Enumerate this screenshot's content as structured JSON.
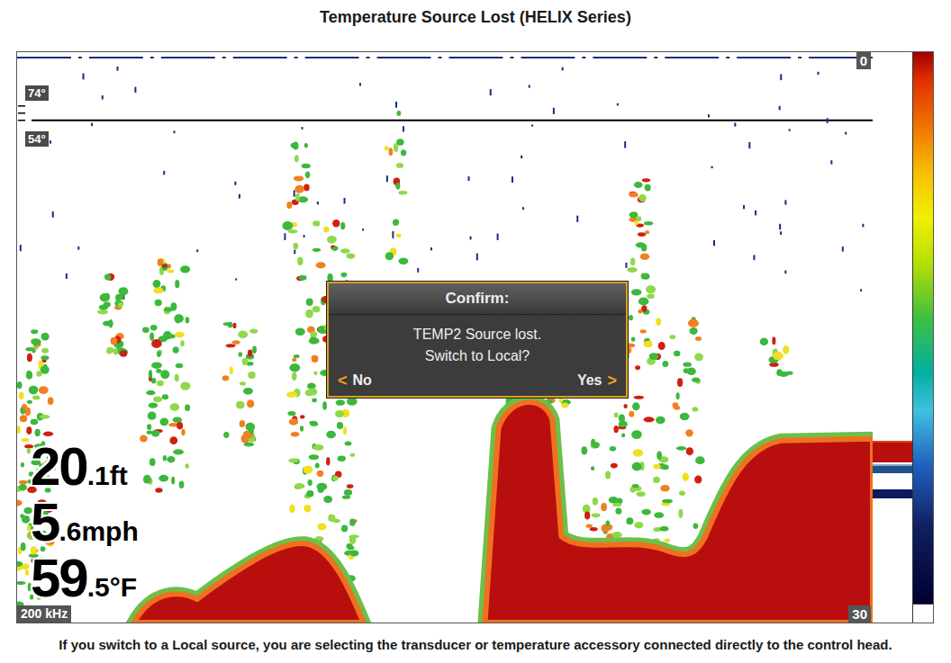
{
  "title": "Temperature Source Lost (HELIX Series)",
  "screen": {
    "temp_scale": [
      "74°",
      "54°"
    ],
    "depth_top": "0",
    "depth_bottom": "30",
    "frequency": "200 kHz",
    "readouts": [
      {
        "value": "20",
        "detail": ".1ft"
      },
      {
        "value": "5",
        "detail": ".6mph"
      },
      {
        "value": "59",
        "detail": ".5°F"
      }
    ],
    "dialog": {
      "title": "Confirm:",
      "lines": [
        "TEMP2 Source lost.",
        "Switch to Local?"
      ],
      "buttons": [
        {
          "label": "No",
          "arrow": "<",
          "kind": "back"
        },
        {
          "label": "Yes",
          "arrow": ">",
          "kind": "forward"
        }
      ]
    }
  },
  "caption": "If you switch to a Local source, you are selecting the transducer or temperature accessory connected directly to the control head."
}
